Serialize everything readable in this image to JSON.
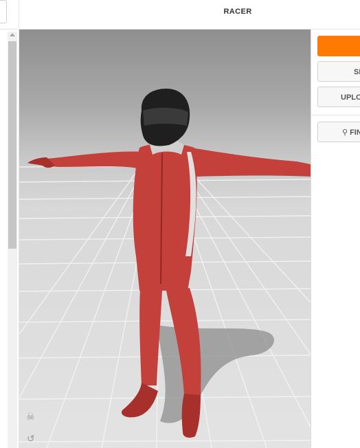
{
  "header": {
    "title": "RACER"
  },
  "panel": {
    "primary_button": "",
    "secondary_button_1": "SE",
    "secondary_button_2": "UPLO",
    "find_button": "FIN"
  },
  "viewport": {
    "skull_icon": "skull-icon",
    "reset_icon": "rotate-icon"
  },
  "colors": {
    "accent": "#ff7a00",
    "suit_red": "#c4403b",
    "helmet": "#1f1f1f",
    "background_top": "#8f8f8f",
    "floor": "#e3e3e3"
  }
}
